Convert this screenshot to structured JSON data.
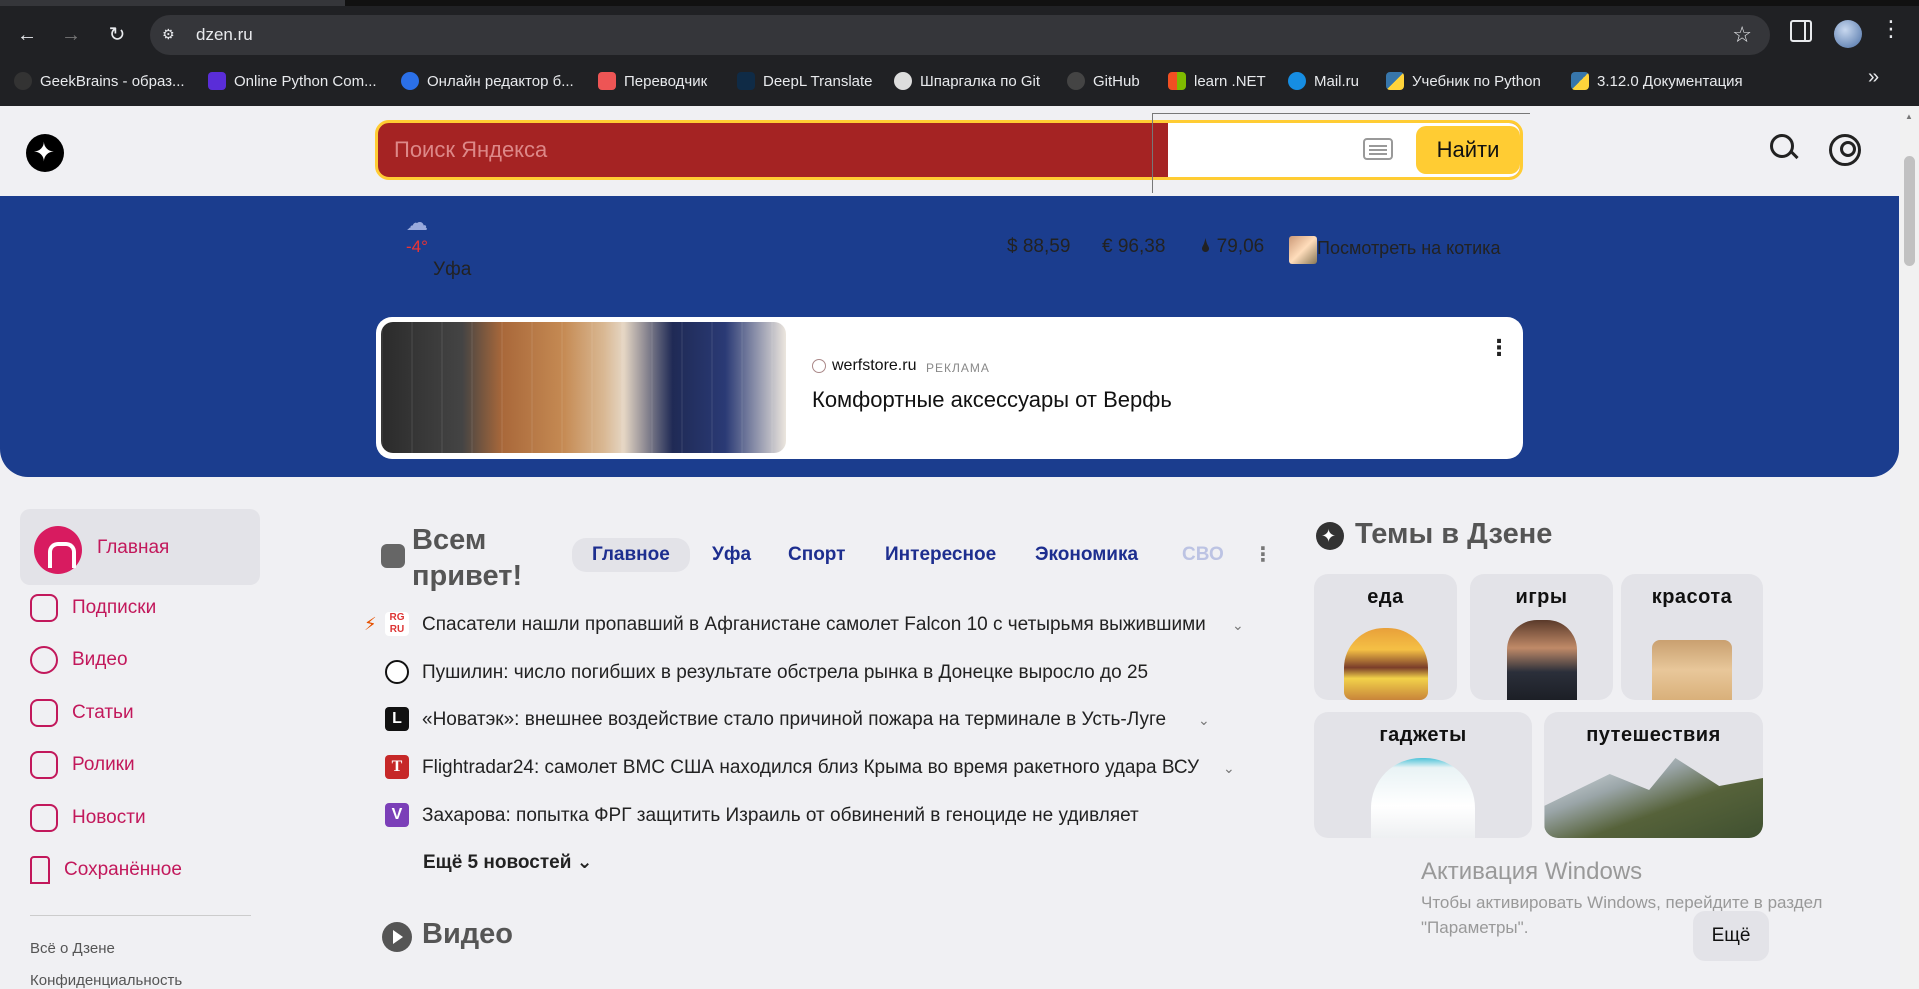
{
  "browser": {
    "url": "dzen.ru",
    "bookmarks": [
      {
        "label": "GeekBrains - образ...",
        "color": "#333"
      },
      {
        "label": "Online Python Com...",
        "color": "#5a2dd8"
      },
      {
        "label": "Онлайн редактор б...",
        "color": "#2b70e8"
      },
      {
        "label": "Переводчик",
        "color": "#e55"
      },
      {
        "label": "DeepL Translate",
        "color": "#0f2b46"
      },
      {
        "label": "Шпаргалка по Git",
        "color": "#ddd"
      },
      {
        "label": "GitHub",
        "color": "#444"
      },
      {
        "label": "learn .NET",
        "color": "#f25022"
      },
      {
        "label": "Mail.ru",
        "color": "#168de2"
      },
      {
        "label": "Учебник по Python",
        "color": "#3776ab"
      },
      {
        "label": "3.12.0 Документация",
        "color": "#ffd43b"
      }
    ]
  },
  "header": {
    "search_placeholder": "Поиск Яндекса",
    "find_label": "Найти"
  },
  "banner": {
    "temperature": "-4°",
    "city": "Уфа",
    "usd": "$ 88,59",
    "eur": "€ 96,38",
    "oil": "🌢 79,06",
    "cat_link": "Посмотреть на котика"
  },
  "ad": {
    "domain": "werfstore.ru",
    "label": "РЕКЛАМА",
    "title": "Комфортные аксессуары от Верфь"
  },
  "sidenav": {
    "home": "Главная",
    "items": [
      "Подписки",
      "Видео",
      "Статьи",
      "Ролики",
      "Новости",
      "Сохранённое"
    ],
    "footer": [
      "Всё о Дзене",
      "Конфиденциальность"
    ]
  },
  "news": {
    "greeting": "Всем привет!",
    "tabs": [
      "Главное",
      "Уфа",
      "Спорт",
      "Интересное",
      "Экономика",
      "СВО"
    ],
    "items": [
      {
        "text": "Спасатели нашли пропавший в Афганистане самолет Falcon 10 с четырьмя выжившими",
        "source": "RG RU",
        "color": "#d33"
      },
      {
        "text": "Пушилин: число погибших в результате обстрела рынка в Донецке выросло до 25",
        "source": "logo",
        "color": "#fff"
      },
      {
        "text": "«Новатэк»: внешнее воздействие стало причиной пожара на терминале в Усть-Луге",
        "source": "L",
        "color": "#111"
      },
      {
        "text": "Flightradar24: самолет ВМС США находился близ Крыма во время ракетного удара ВСУ",
        "source": "T",
        "color": "#c62828"
      },
      {
        "text": "Захарова: попытка ФРГ защитить Израиль от обвинений в геноциде не удивляет",
        "source": "V",
        "color": "#7b3fb8"
      }
    ],
    "more": "Ещё 5 новостей"
  },
  "video": {
    "title": "Видео"
  },
  "themes": {
    "title": "Темы в Дзене",
    "cards": [
      "еда",
      "игры",
      "красота",
      "гаджеты",
      "путешествия"
    ],
    "more_button": "Ещё"
  },
  "windows": {
    "title": "Активация Windows",
    "subtitle": "Чтобы активировать Windows, перейдите в раздел \"Параметры\"."
  }
}
